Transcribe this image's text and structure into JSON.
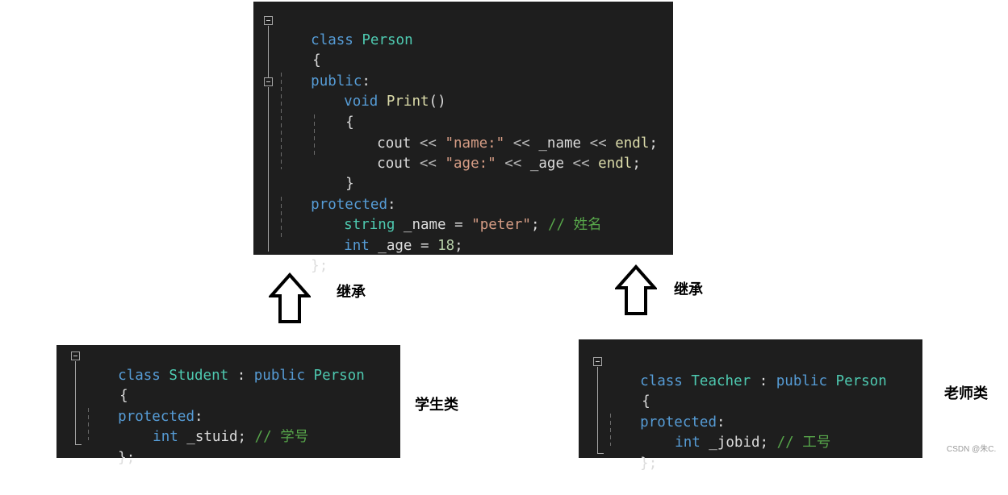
{
  "person_block": {
    "line1": {
      "kw": "class",
      "name": "Person"
    },
    "line2": "{",
    "line3": {
      "kw": "public",
      "colon": ":"
    },
    "line4": {
      "kw": "void",
      "fn": "Print",
      "parens": "()"
    },
    "line5": "{",
    "line6": {
      "obj": "cout",
      "op1": " << ",
      "str": "\"name:\"",
      "op2": " << ",
      "var": "_name",
      "op3": " << ",
      "fn": "endl",
      "semi": ";"
    },
    "line7": {
      "obj": "cout",
      "op1": " << ",
      "str": "\"age:\"",
      "op2": " << ",
      "var": "_age",
      "op3": " << ",
      "fn": "endl",
      "semi": ";"
    },
    "line8": "}",
    "line9": {
      "kw": "protected",
      "colon": ":"
    },
    "line10": {
      "ty": "string",
      "var": " _name = ",
      "str": "\"peter\"",
      "semi": ";",
      "comment": " // 姓名"
    },
    "line11": {
      "kw": "int",
      "var": " _age = ",
      "num": "18",
      "semi": ";"
    },
    "line12": "};"
  },
  "student_block": {
    "line1": {
      "kw": "class",
      "name": "Student",
      "sep": " : ",
      "kw2": "public",
      "base": "Person"
    },
    "line2": "{",
    "line3": {
      "kw": "protected",
      "colon": ":"
    },
    "line4": {
      "kw": "int",
      "var": " _stuid",
      "semi": ";",
      "comment": " // 学号"
    },
    "line5": "};"
  },
  "teacher_block": {
    "line1": {
      "kw": "class",
      "name": "Teacher",
      "sep": " : ",
      "kw2": "public",
      "base": "Person"
    },
    "line2": "{",
    "line3": {
      "kw": "protected",
      "colon": ":"
    },
    "line4": {
      "kw": "int",
      "var": " _jobid",
      "semi": ";",
      "comment": " // 工号"
    },
    "line5": "};"
  },
  "labels": {
    "inherit_left": "继承",
    "inherit_right": "继承",
    "student_class": "学生类",
    "teacher_class": "老师类"
  },
  "watermark": "CSDN @朱C.",
  "colors": {
    "editor_bg": "#1e1e1e",
    "keyword": "#569cd6",
    "type": "#4ec9b0",
    "function": "#dcdcaa",
    "string": "#d69d85",
    "comment": "#57a64a",
    "number": "#b5cea8"
  }
}
